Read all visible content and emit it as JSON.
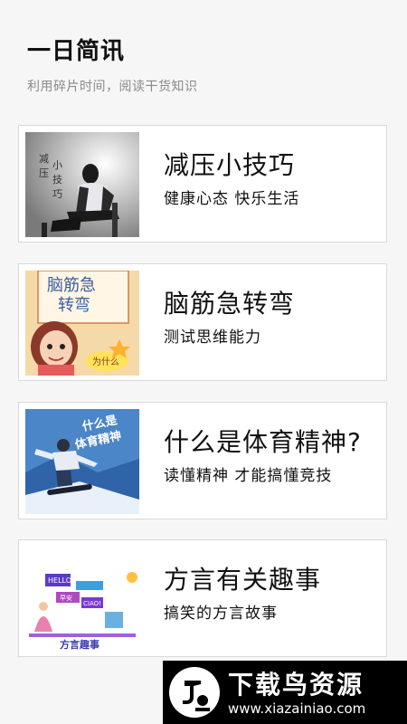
{
  "header": {
    "title": "一日简讯",
    "subtitle": "利用碎片时间，阅读干货知识"
  },
  "cards": [
    {
      "title": "减压小技巧",
      "desc": "健康心态 快乐生活",
      "thumb_text": [
        "减",
        "压",
        "小",
        "技",
        "巧"
      ]
    },
    {
      "title": "脑筋急转弯",
      "desc": "测试思维能力",
      "thumb_text": [
        "脑筋急",
        "转弯",
        "为什么"
      ]
    },
    {
      "title": "什么是体育精神?",
      "desc": "读懂精神 才能搞懂竞技",
      "thumb_text": [
        "什么是",
        "体育精神"
      ]
    },
    {
      "title": "方言有关趣事",
      "desc": "搞笑的方言故事",
      "thumb_text": [
        "方言趣事",
        "HELLO!",
        "早安",
        "CIAO!"
      ]
    }
  ],
  "watermark": {
    "title": "下载鸟资源",
    "url": "www.xiazainiao.com"
  }
}
